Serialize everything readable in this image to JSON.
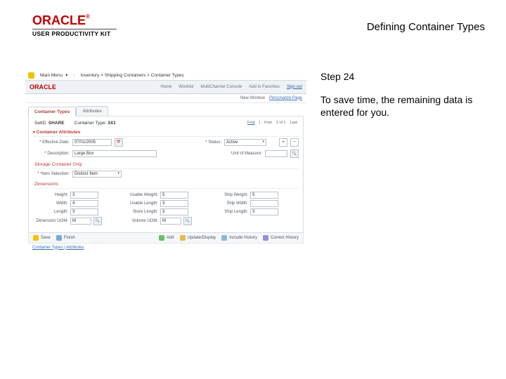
{
  "header": {
    "brand": "ORACLE",
    "brand_mark": "®",
    "brand_sub": "USER PRODUCTIVITY KIT",
    "page_title": "Defining Container Types"
  },
  "side": {
    "step": "Step 24",
    "desc": "To save time, the remaining data is entered for you."
  },
  "app": {
    "fav_tab": "Main Menu",
    "breadcrumb": "Inventory  >  Shipping Containers  >  Container Types",
    "brand": "ORACLE",
    "nav": {
      "home": "Home",
      "worklist": "Worklist",
      "mcc": "MultiChannel Console",
      "atf": "Add to Favorites",
      "signout": "Sign out"
    },
    "subnav": {
      "new": "New Window",
      "pers": "Personalize Page"
    },
    "tabs": {
      "types": "Container Types",
      "attrs": "Attributes"
    },
    "quick": {
      "setid_l": "SetID:",
      "setid_v": "SHARE",
      "ctype_l": "Container Type:",
      "ctype_v": "3X1",
      "find": "Find",
      "first": "First",
      "pager": "1 of 1",
      "last": "Last"
    },
    "sec_attrs": "Container Attributes",
    "fields": {
      "eff_l": "Effective Date:",
      "eff_v": "07/01/2005",
      "status_l": "Status:",
      "status_v": "Active",
      "desc_l": "Description:",
      "desc_v": "Large Box",
      "uom_l": "Unit of Measure:"
    },
    "sec_store": "Storage Container Only",
    "store": {
      "itemsel_l": "*Item Selection:",
      "itemsel_v": "Distinct Item"
    },
    "sec_dims": "Dimensions",
    "dims": {
      "height_l": "Height:",
      "height_v": "3",
      "width_l": "Width:",
      "width_v": "4",
      "length_l": "Length:",
      "length_v": "3",
      "dimuom_l": "Dimension UOM:",
      "dimuom_v": "M",
      "usablew_l": "Usable Weight:",
      "usablew_v": "5",
      "usablel_l": "Usable Length:",
      "usablel_v": "3",
      "storel_l": "Store Length:",
      "storel_v": "3",
      "voluom_l": "Volume UOM:",
      "voluom_v": "M",
      "shipw_l": "Ship Weight:",
      "shipw_v": "5",
      "shipwid_l": "Ship Width:",
      "shipwid_v": ".",
      "shiplen_l": "Ship Length:",
      "shiplen_v": "3"
    },
    "footer": {
      "save": "Save",
      "finish": "Finish",
      "add": "Add",
      "upd": "Update/Display",
      "loc": "Include History",
      "cur": "Correct History"
    },
    "bottom_tabs": "Container Types | Attributes"
  }
}
